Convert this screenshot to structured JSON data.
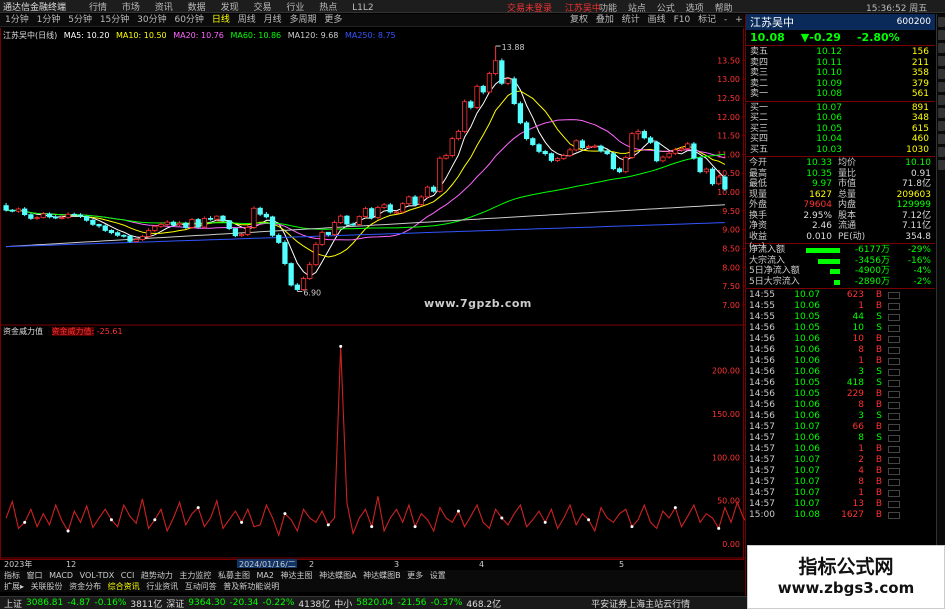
{
  "titlebar": {
    "app": "通达信金融终端",
    "menu": [
      "行情",
      "市场",
      "资讯",
      "数据",
      "发现",
      "交易",
      "行业",
      "热点",
      "L1L2"
    ],
    "center": [
      "交易未登录",
      "江苏吴中"
    ],
    "right": [
      "功能",
      "站点",
      "公式",
      "选项",
      "帮助"
    ],
    "time": "15:36:52 周五"
  },
  "periods": [
    "1分钟",
    "1分钟",
    "5分钟",
    "15分钟",
    "30分钟",
    "60分钟",
    "日线",
    "周线",
    "月线",
    "多周期",
    "更多"
  ],
  "period_right": [
    "复权",
    "叠加",
    "统计",
    "画线",
    "F10",
    "标记",
    "-",
    "+"
  ],
  "ma_legend": {
    "title": "江苏吴中(日线)",
    "items": [
      "MA5: 10.20",
      "MA10: 10.50",
      "MA20: 10.76",
      "MA60: 10.86",
      "MA120: 9.68",
      "MA250: 8.75"
    ],
    "colors": [
      "#ffffff",
      "#ffff00",
      "#ff66ff",
      "#00ff00",
      "#cccccc",
      "#3355ff"
    ]
  },
  "sub_legend": {
    "name": "资金威力值",
    "label": "资金威力值:",
    "value": "-25.61"
  },
  "watermark_url": "www.7gpzb.com",
  "bottom_tabs": [
    "指标",
    "窗口",
    "MACD",
    "VOL-TDX",
    "CCI",
    "趋势动力",
    "主力监控",
    "私募主图",
    "MA2",
    "神达主图",
    "神达蝶图A",
    "神达蝶图B",
    "更多",
    "设置"
  ],
  "bottom_tabs2": [
    "扩展▸",
    "关联股份",
    "资金分布",
    "综合资讯",
    "行业资讯",
    "互动问答",
    "普及新功能说明"
  ],
  "status": {
    "sh_label": "上证",
    "sh_val": "3086.81",
    "sh_chg": "-4.87",
    "sh_pct": "-0.16%",
    "sh_amt": "3811亿",
    "sz_label": "深证",
    "sz_val": "9364.30",
    "sz_chg": "-20.34",
    "sz_pct": "-0.22%",
    "sz_amt": "4138亿",
    "zx_label": "中小",
    "zx_val": "5820.04",
    "zx_chg": "-21.56",
    "zx_pct": "-0.37%",
    "zx_amt": "468.2亿",
    "server": "平安证券上海主站云行情"
  },
  "quote": {
    "name": "江苏吴中",
    "code": "600200",
    "price": "10.08",
    "change": "▼-0.29",
    "pct": "-2.80%",
    "sells": [
      {
        "l": "卖五",
        "p": "10.12",
        "v": "156"
      },
      {
        "l": "卖四",
        "p": "10.11",
        "v": "211"
      },
      {
        "l": "卖三",
        "p": "10.10",
        "v": "358"
      },
      {
        "l": "卖二",
        "p": "10.09",
        "v": "379"
      },
      {
        "l": "卖一",
        "p": "10.08",
        "v": "561"
      }
    ],
    "buys": [
      {
        "l": "买一",
        "p": "10.07",
        "v": "891"
      },
      {
        "l": "买二",
        "p": "10.06",
        "v": "348"
      },
      {
        "l": "买三",
        "p": "10.05",
        "v": "615"
      },
      {
        "l": "买四",
        "p": "10.04",
        "v": "460"
      },
      {
        "l": "买五",
        "p": "10.03",
        "v": "1030"
      }
    ],
    "info": [
      [
        "今开",
        "10.33",
        "均价",
        "10.10"
      ],
      [
        "最高",
        "10.35",
        "量比",
        "0.91"
      ],
      [
        "最低",
        "9.97",
        "市值",
        "71.8亿"
      ],
      [
        "现量",
        "1627",
        "总量",
        "209603"
      ],
      [
        "外盘",
        "79604",
        "内盘",
        "129999"
      ],
      [
        "换手",
        "2.95%",
        "股本",
        "7.12亿"
      ],
      [
        "净资",
        "2.46",
        "流通",
        "7.11亿"
      ],
      [
        "收益(一)",
        "0.010",
        "PE(动)",
        "354.8"
      ]
    ],
    "funds": [
      {
        "l": "净流入额",
        "v": "-6177万",
        "p": "-29%",
        "w": 34
      },
      {
        "l": "大宗流入",
        "v": "-3456万",
        "p": "-16%",
        "w": 22
      },
      {
        "l": "5日净流入额",
        "v": "-4900万",
        "p": "-4%",
        "w": 10
      },
      {
        "l": "5日大宗流入",
        "v": "-2890万",
        "p": "-2%",
        "w": 6
      }
    ],
    "ticks": [
      [
        "14:55",
        "10.07",
        "623",
        "B"
      ],
      [
        "14:55",
        "10.06",
        "1",
        "B"
      ],
      [
        "14:55",
        "10.05",
        "44",
        "S"
      ],
      [
        "14:56",
        "10.05",
        "10",
        "S"
      ],
      [
        "14:56",
        "10.06",
        "10",
        "B"
      ],
      [
        "14:56",
        "10.06",
        "8",
        "B"
      ],
      [
        "14:56",
        "10.06",
        "1",
        "B"
      ],
      [
        "14:56",
        "10.06",
        "3",
        "S"
      ],
      [
        "14:56",
        "10.05",
        "418",
        "S"
      ],
      [
        "14:56",
        "10.05",
        "229",
        "B"
      ],
      [
        "14:56",
        "10.06",
        "8",
        "B"
      ],
      [
        "14:56",
        "10.06",
        "3",
        "S"
      ],
      [
        "14:57",
        "10.07",
        "66",
        "B"
      ],
      [
        "14:57",
        "10.06",
        "8",
        "S"
      ],
      [
        "14:57",
        "10.06",
        "1",
        "B"
      ],
      [
        "14:57",
        "10.07",
        "2",
        "B"
      ],
      [
        "14:57",
        "10.07",
        "4",
        "B"
      ],
      [
        "14:57",
        "10.07",
        "8",
        "B"
      ],
      [
        "14:57",
        "10.07",
        "1",
        "B"
      ],
      [
        "14:57",
        "10.07",
        "13",
        "B"
      ],
      [
        "15:00",
        "10.08",
        "1627",
        "B"
      ]
    ]
  },
  "chart_data": {
    "type": "candlestick",
    "y_ticks": [
      7.0,
      7.5,
      8.0,
      8.5,
      9.0,
      9.5,
      10.0,
      10.5,
      11.0,
      11.5,
      12.0,
      12.5,
      13.0,
      13.5
    ],
    "annotations": [
      {
        "text": "13.88",
        "at": "high"
      },
      {
        "text": "6.90",
        "at": "low"
      }
    ],
    "x_labels": [
      "2023年",
      "12",
      "2024/01/16/二",
      "2",
      "3",
      "4",
      "5"
    ],
    "open": [
      9.64,
      9.52,
      9.49,
      9.55,
      9.4,
      9.3,
      9.32,
      9.42,
      9.34,
      9.31,
      9.32,
      9.41,
      9.39,
      9.35,
      9.25,
      9.14,
      9.1,
      8.98,
      8.92,
      8.85,
      8.83,
      8.69,
      8.74,
      8.82,
      8.98,
      9.09,
      9.14,
      9.2,
      9.13,
      9.17,
      9.06,
      9.27,
      9.07,
      9.3,
      9.28,
      9.36,
      9.24,
      9.03,
      8.84,
      8.87,
      9.06,
      9.57,
      9.41,
      9.34,
      8.85,
      8.66,
      8.1,
      7.53,
      7.41,
      7.7,
      8.07,
      8.61,
      8.93,
      8.87,
      9.19,
      9.36,
      9.15,
      9.14,
      9.35,
      9.56,
      9.32,
      9.59,
      9.66,
      9.47,
      9.47,
      9.69,
      9.87,
      9.67,
      9.87,
      10.13,
      10.02,
      10.9,
      10.97,
      11.42,
      11.61,
      12.4,
      12.25,
      12.81,
      12.66,
      13.15,
      13.49,
      12.89,
      13.01,
      12.35,
      11.84,
      11.42,
      11.26,
      11.08,
      11.02,
      10.84,
      10.89,
      10.97,
      11.12,
      11.36,
      11.18,
      11.21,
      11.22,
      11.09,
      11.02,
      10.62,
      10.54,
      10.92,
      11.55,
      11.61,
      11.44,
      11.32,
      10.83,
      10.93,
      11.03,
      11.12,
      11.16,
      11.28,
      10.9,
      10.54,
      10.61,
      10.22,
      10.4
    ],
    "close": [
      9.52,
      9.49,
      9.55,
      9.4,
      9.3,
      9.32,
      9.42,
      9.34,
      9.31,
      9.32,
      9.41,
      9.39,
      9.35,
      9.25,
      9.14,
      9.1,
      8.98,
      8.92,
      8.85,
      8.83,
      8.69,
      8.74,
      8.82,
      8.98,
      9.09,
      9.14,
      9.2,
      9.13,
      9.17,
      9.06,
      9.27,
      9.07,
      9.3,
      9.28,
      9.36,
      9.24,
      9.03,
      8.84,
      8.87,
      9.06,
      9.57,
      9.41,
      9.34,
      8.85,
      8.66,
      8.1,
      7.53,
      7.41,
      7.7,
      8.07,
      8.61,
      8.93,
      8.87,
      9.19,
      9.36,
      9.15,
      9.14,
      9.35,
      9.56,
      9.32,
      9.59,
      9.66,
      9.47,
      9.47,
      9.69,
      9.87,
      9.67,
      9.87,
      10.13,
      10.02,
      10.9,
      10.97,
      11.42,
      11.61,
      12.4,
      12.25,
      12.81,
      12.66,
      13.15,
      13.49,
      12.89,
      13.01,
      12.35,
      11.84,
      11.42,
      11.26,
      11.08,
      11.02,
      10.84,
      10.89,
      10.97,
      11.12,
      11.36,
      11.18,
      11.21,
      11.22,
      11.09,
      11.02,
      10.62,
      10.54,
      10.92,
      11.55,
      11.61,
      11.44,
      11.32,
      10.83,
      10.93,
      11.03,
      11.12,
      11.16,
      11.28,
      10.9,
      10.54,
      10.61,
      10.22,
      10.4,
      10.08
    ],
    "high": [
      9.71,
      9.55,
      9.59,
      9.6,
      9.43,
      9.36,
      9.47,
      9.46,
      9.39,
      9.37,
      9.46,
      9.45,
      9.44,
      9.37,
      9.28,
      9.16,
      9.14,
      9.01,
      8.96,
      8.88,
      8.84,
      8.77,
      8.86,
      9.04,
      9.12,
      9.2,
      9.25,
      9.24,
      9.23,
      9.21,
      9.31,
      9.31,
      9.35,
      9.36,
      9.38,
      9.39,
      9.25,
      9.05,
      8.9,
      9.11,
      9.62,
      9.61,
      9.47,
      9.37,
      8.9,
      8.72,
      8.13,
      7.58,
      7.75,
      8.14,
      8.67,
      8.98,
      8.94,
      9.24,
      9.4,
      9.39,
      9.19,
      9.38,
      9.61,
      9.6,
      9.64,
      9.71,
      9.71,
      9.5,
      9.73,
      9.91,
      9.92,
      9.92,
      10.17,
      10.18,
      10.95,
      11.02,
      11.47,
      11.66,
      12.46,
      12.45,
      12.86,
      12.85,
      13.2,
      13.88,
      13.55,
      13.05,
      13.07,
      12.41,
      11.89,
      11.46,
      11.3,
      11.12,
      11.05,
      10.93,
      11.02,
      11.18,
      11.4,
      11.41,
      11.26,
      11.27,
      11.26,
      11.13,
      11.06,
      10.66,
      10.97,
      11.6,
      11.67,
      11.66,
      11.49,
      11.36,
      10.97,
      11.08,
      11.18,
      11.21,
      11.33,
      11.33,
      10.94,
      10.65,
      10.66,
      10.45,
      10.45
    ],
    "low": [
      9.48,
      9.46,
      9.45,
      9.36,
      9.26,
      9.26,
      9.3,
      9.3,
      9.28,
      9.27,
      9.29,
      9.35,
      9.31,
      9.21,
      9.1,
      9.05,
      8.94,
      8.88,
      8.81,
      8.79,
      8.65,
      8.66,
      8.7,
      8.78,
      8.94,
      9.05,
      9.1,
      9.08,
      9.09,
      9.02,
      9.02,
      9.03,
      9.03,
      9.24,
      9.24,
      9.2,
      8.99,
      8.8,
      8.81,
      8.83,
      9.02,
      9.36,
      9.3,
      8.81,
      8.62,
      8.05,
      7.49,
      7.36,
      7.37,
      7.66,
      8.03,
      8.57,
      8.82,
      8.83,
      9.15,
      9.1,
      9.1,
      9.1,
      9.31,
      9.27,
      9.27,
      9.55,
      9.43,
      9.42,
      9.43,
      9.65,
      9.62,
      9.62,
      9.82,
      9.98,
      9.98,
      10.86,
      10.92,
      11.37,
      11.56,
      12.2,
      12.2,
      12.6,
      12.62,
      13.1,
      12.84,
      12.84,
      12.31,
      11.8,
      11.37,
      11.22,
      11.03,
      10.97,
      10.79,
      10.8,
      10.85,
      10.93,
      11.08,
      11.14,
      11.16,
      11.17,
      11.05,
      10.98,
      10.58,
      10.5,
      10.5,
      10.88,
      11.39,
      11.4,
      11.28,
      10.79,
      10.79,
      10.89,
      10.98,
      11.07,
      11.11,
      10.86,
      10.5,
      10.49,
      10.17,
      10.18,
      10.03
    ],
    "sub_ticks": [
      0,
      50,
      100,
      150,
      200
    ],
    "sub_marker": "167.64",
    "sub_values": [
      30,
      49,
      18,
      25,
      40,
      20,
      35,
      22,
      45,
      27,
      15,
      38,
      25,
      44,
      19,
      30,
      40,
      28,
      20,
      45,
      32,
      24,
      52,
      18,
      28,
      40,
      15,
      30,
      48,
      22,
      35,
      42,
      20,
      30,
      50,
      18,
      28,
      38,
      25,
      40,
      20,
      22,
      45,
      30,
      10,
      35,
      28,
      15,
      40,
      30,
      25,
      38,
      22,
      30,
      228,
      48,
      12,
      30,
      40,
      20,
      55,
      15,
      30,
      40,
      25,
      45,
      20,
      35,
      28,
      15,
      42,
      30,
      25,
      38,
      20,
      32,
      45,
      25,
      18,
      40,
      30,
      22,
      35,
      45,
      20,
      28,
      38,
      25,
      40,
      18,
      30,
      45,
      22,
      35,
      28,
      15,
      42,
      30,
      25,
      35,
      40,
      20,
      28,
      45,
      25,
      18,
      38,
      30,
      42,
      20,
      32,
      45,
      25,
      35,
      30,
      18,
      42,
      25,
      48,
      30,
      20
    ]
  }
}
